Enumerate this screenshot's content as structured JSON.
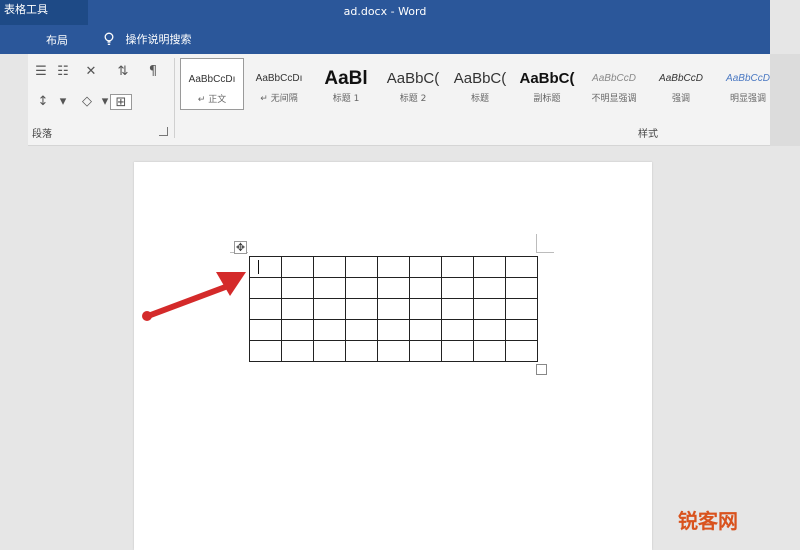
{
  "title_bar": {
    "context_tab": "表格工具",
    "document_title": "ad.docx - Word"
  },
  "tabs": {
    "layout": "布局",
    "tell_me": "操作说明搜索"
  },
  "ribbon": {
    "paragraph_group_label": "段落",
    "styles_group_label": "样式",
    "styles": [
      {
        "sample": "AaBbCcDı",
        "name": "↵ 正文"
      },
      {
        "sample": "AaBbCcDı",
        "name": "↵ 无间隔"
      },
      {
        "sample": "AaBl",
        "name": "标题 1"
      },
      {
        "sample": "AaBbC(",
        "name": "标题 2"
      },
      {
        "sample": "AaBbC(",
        "name": "标题"
      },
      {
        "sample": "AaBbC(",
        "name": "副标题"
      },
      {
        "sample": "AaBbCcD",
        "name": "不明显强调"
      },
      {
        "sample": "AaBbCcD",
        "name": "强调"
      },
      {
        "sample": "AaBbCcD",
        "name": "明显强调"
      }
    ]
  },
  "document": {
    "table": {
      "rows": 5,
      "cols": 9
    }
  },
  "annotation": {
    "arrow_color": "#d42a2a"
  },
  "watermark": "锐客网",
  "colors": {
    "accent": "#2b579a",
    "context_tab": "#1e4a86"
  }
}
